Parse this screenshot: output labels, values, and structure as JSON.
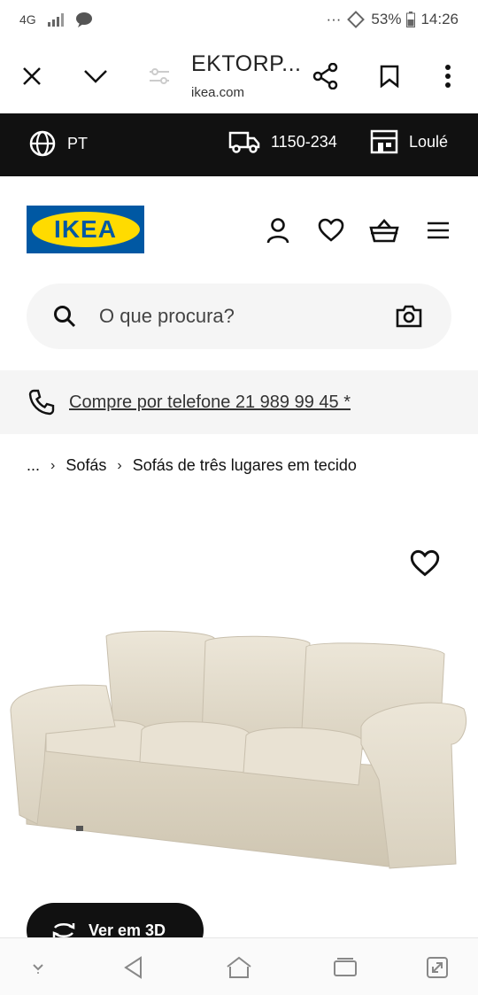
{
  "status": {
    "network": "4G",
    "battery": "53%",
    "time": "14:26",
    "dots": "···"
  },
  "browser": {
    "title": "EKTORP...",
    "url": "ikea.com"
  },
  "topbar": {
    "language": "PT",
    "postcode": "1150-234",
    "store": "Loulé"
  },
  "header": {
    "logo_text": "IKEA"
  },
  "search": {
    "placeholder": "O que procura?"
  },
  "phone": {
    "link_text": "Compre por telefone 21 989 99 45 *"
  },
  "breadcrumb": {
    "ellipsis": "...",
    "items": [
      "Sofás",
      "Sofás de três lugares em tecido"
    ]
  },
  "product": {
    "view3d_label": "Ver em 3D"
  },
  "colors": {
    "ikea_blue": "#0058a3",
    "ikea_yellow": "#ffdb00",
    "topbar_bg": "#111111",
    "sofa_fabric": "#e4ddcd"
  }
}
